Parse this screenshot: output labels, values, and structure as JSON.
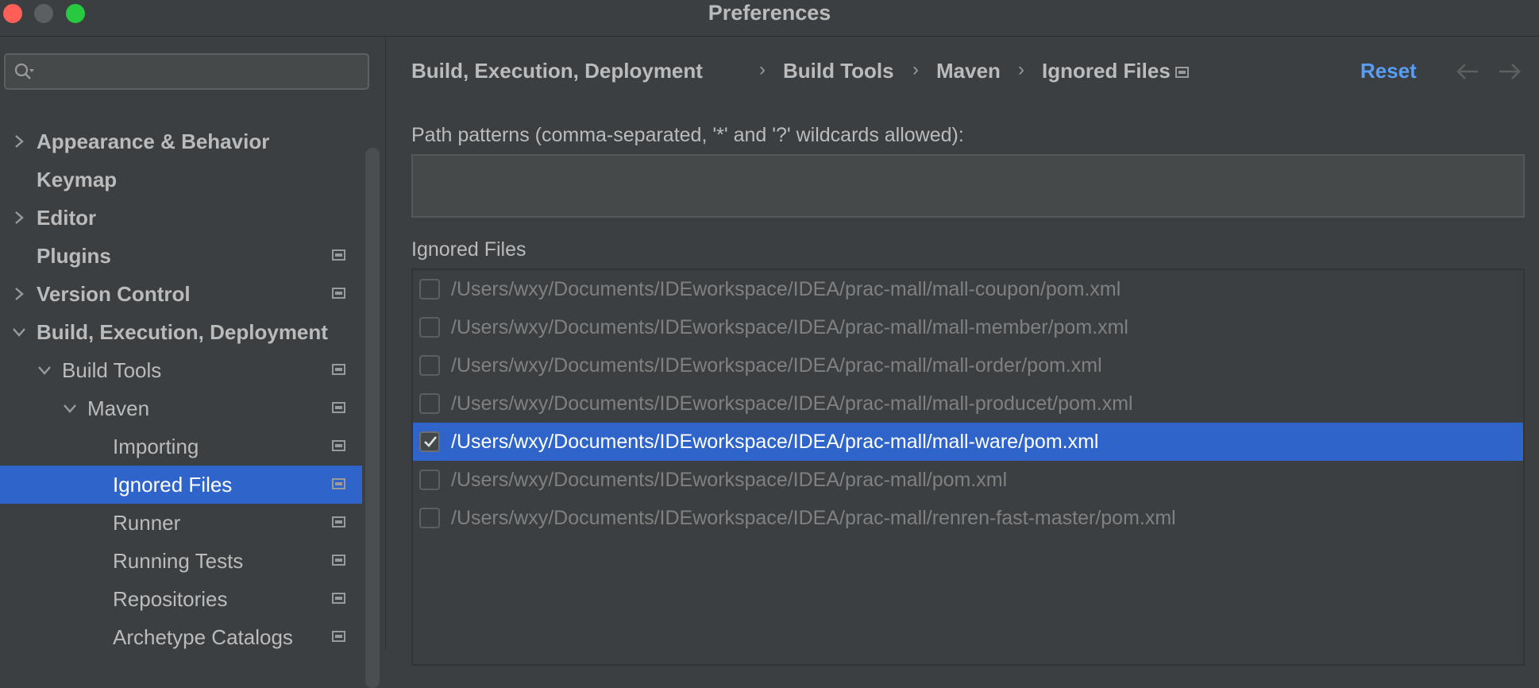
{
  "window": {
    "title": "Preferences"
  },
  "search": {
    "placeholder": "",
    "value": ""
  },
  "sidebar": {
    "items": [
      {
        "label": "Appearance & Behavior"
      },
      {
        "label": "Keymap"
      },
      {
        "label": "Editor"
      },
      {
        "label": "Plugins"
      },
      {
        "label": "Version Control"
      },
      {
        "label": "Build, Execution, Deployment"
      },
      {
        "label": "Build Tools"
      },
      {
        "label": "Maven"
      },
      {
        "label": "Importing"
      },
      {
        "label": "Ignored Files"
      },
      {
        "label": "Runner"
      },
      {
        "label": "Running Tests"
      },
      {
        "label": "Repositories"
      },
      {
        "label": "Archetype Catalogs"
      }
    ],
    "selected": "Ignored Files"
  },
  "breadcrumb": [
    "Build, Execution, Deployment",
    "Build Tools",
    "Maven",
    "Ignored Files"
  ],
  "breadcrumb_separator": "›",
  "header": {
    "reset_label": "Reset"
  },
  "patterns": {
    "label": "Path patterns (comma-separated, '*' and '?' wildcards allowed):",
    "value": ""
  },
  "ignored_files": {
    "label": "Ignored Files",
    "items": [
      {
        "path": "/Users/wxy/Documents/IDEworkspace/IDEA/prac-mall/mall-coupon/pom.xml",
        "checked": false
      },
      {
        "path": "/Users/wxy/Documents/IDEworkspace/IDEA/prac-mall/mall-member/pom.xml",
        "checked": false
      },
      {
        "path": "/Users/wxy/Documents/IDEworkspace/IDEA/prac-mall/mall-order/pom.xml",
        "checked": false
      },
      {
        "path": "/Users/wxy/Documents/IDEworkspace/IDEA/prac-mall/mall-producet/pom.xml",
        "checked": false
      },
      {
        "path": "/Users/wxy/Documents/IDEworkspace/IDEA/prac-mall/mall-ware/pom.xml",
        "checked": true
      },
      {
        "path": "/Users/wxy/Documents/IDEworkspace/IDEA/prac-mall/pom.xml",
        "checked": false
      },
      {
        "path": "/Users/wxy/Documents/IDEworkspace/IDEA/prac-mall/renren-fast-master/pom.xml",
        "checked": false
      }
    ]
  },
  "colors": {
    "accent": "#589df6",
    "selection": "#2f65ca",
    "background": "#3c3f41"
  }
}
